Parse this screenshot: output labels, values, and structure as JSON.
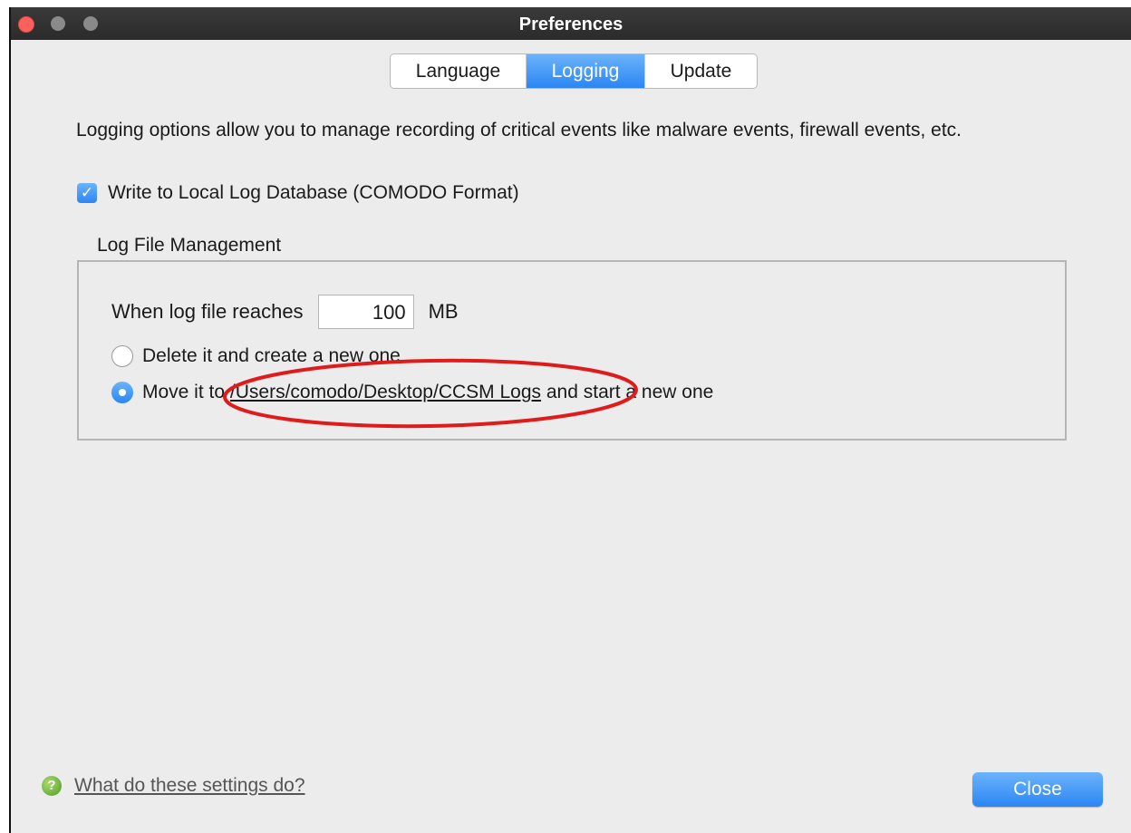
{
  "window": {
    "title": "Preferences"
  },
  "tabs": [
    {
      "label": "Language",
      "selected": false
    },
    {
      "label": "Logging",
      "selected": true
    },
    {
      "label": "Update",
      "selected": false
    }
  ],
  "description": "Logging options allow you to manage recording of critical events like malware events, firewall events, etc.",
  "write_local_log": {
    "label": "Write to Local Log Database (COMODO Format)",
    "checked": true
  },
  "log_file_management": {
    "title": "Log File Management",
    "size_label": "When log file reaches",
    "size_value": "100",
    "size_unit": "MB",
    "option_delete": {
      "label": "Delete it and create a new one",
      "selected": false
    },
    "option_move": {
      "prefix": "Move it to",
      "path": "/Users/comodo/Desktop/CCSM Logs",
      "suffix": "and start a new one",
      "selected": true
    }
  },
  "footer": {
    "help_link": "What do these settings do?",
    "close_button": "Close"
  },
  "colors": {
    "accent": "#2b86f4",
    "annotation": "#e01b1b",
    "close_light": "#fc605c"
  },
  "icons": {
    "checkbox": "checkmark-icon",
    "help": "question-mark-icon"
  }
}
